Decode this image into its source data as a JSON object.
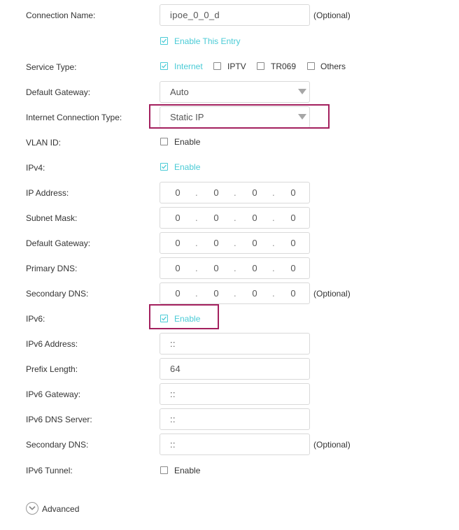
{
  "connection_name": {
    "label": "Connection Name:",
    "value": "ipoe_0_0_d",
    "optional": "(Optional)"
  },
  "enable_entry": {
    "label": "Enable This Entry",
    "checked": true
  },
  "service_type": {
    "label": "Service Type:",
    "options": [
      {
        "label": "Internet",
        "checked": true
      },
      {
        "label": "IPTV",
        "checked": false
      },
      {
        "label": "TR069",
        "checked": false
      },
      {
        "label": "Others",
        "checked": false
      }
    ]
  },
  "default_gateway_select": {
    "label": "Default Gateway:",
    "value": "Auto"
  },
  "internet_connection_type": {
    "label": "Internet Connection Type:",
    "value": "Static IP"
  },
  "vlan_id": {
    "label": "VLAN ID:",
    "checkbox_label": "Enable",
    "checked": false
  },
  "ipv4": {
    "label": "IPv4:",
    "checkbox_label": "Enable",
    "checked": true
  },
  "ip_address": {
    "label": "IP Address:",
    "octets": [
      "0",
      "0",
      "0",
      "0"
    ]
  },
  "subnet_mask": {
    "label": "Subnet Mask:",
    "octets": [
      "0",
      "0",
      "0",
      "0"
    ]
  },
  "default_gateway_ip": {
    "label": "Default Gateway:",
    "octets": [
      "0",
      "0",
      "0",
      "0"
    ]
  },
  "primary_dns": {
    "label": "Primary DNS:",
    "octets": [
      "0",
      "0",
      "0",
      "0"
    ]
  },
  "secondary_dns": {
    "label": "Secondary DNS:",
    "octets": [
      "0",
      "0",
      "0",
      "0"
    ],
    "optional": "(Optional)"
  },
  "ipv6": {
    "label": "IPv6:",
    "checkbox_label": "Enable",
    "checked": true
  },
  "ipv6_address": {
    "label": "IPv6 Address:",
    "value": "::"
  },
  "prefix_length": {
    "label": "Prefix Length:",
    "value": "64"
  },
  "ipv6_gateway": {
    "label": "IPv6 Gateway:",
    "value": "::"
  },
  "ipv6_dns_server": {
    "label": "IPv6 DNS Server:",
    "value": "::"
  },
  "ipv6_secondary_dns": {
    "label": "Secondary DNS:",
    "value": "::",
    "optional": "(Optional)"
  },
  "ipv6_tunnel": {
    "label": "IPv6 Tunnel:",
    "checkbox_label": "Enable",
    "checked": false
  },
  "advanced": {
    "label": "Advanced",
    "icon": "chevron-down-circle-icon"
  },
  "colors": {
    "accent": "#4acbd6",
    "highlight": "#a3205e",
    "border": "#d9d9d9",
    "text": "#333333"
  }
}
